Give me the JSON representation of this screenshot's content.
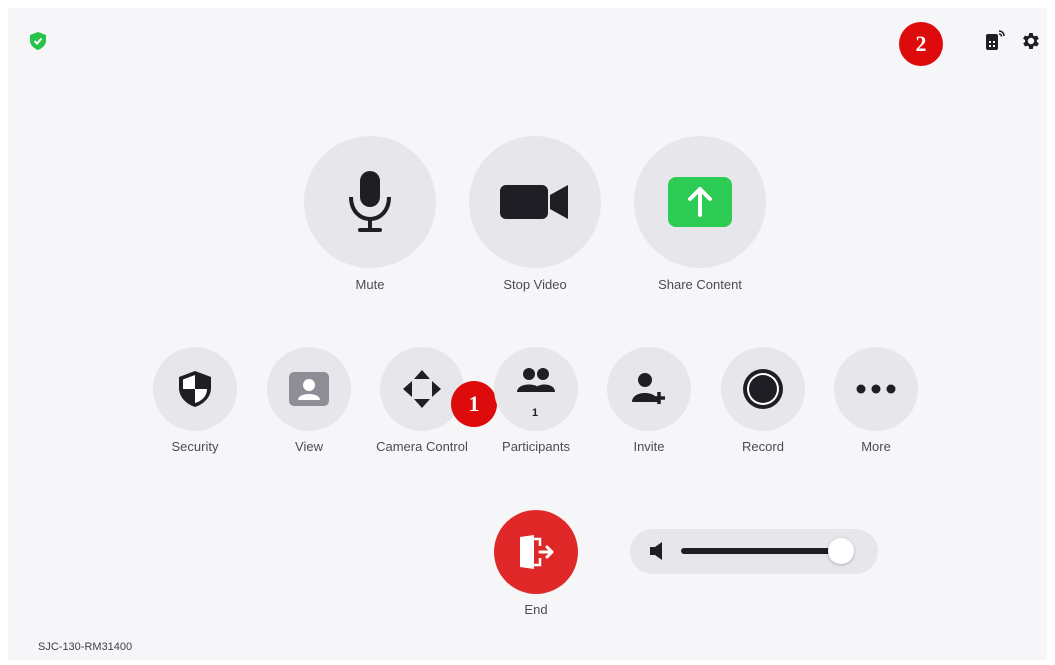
{
  "header": {
    "shield_icon": "shield-check-icon",
    "shield_color": "#26c24a",
    "remote_icon": "remote-control-icon",
    "settings_icon": "gear-icon"
  },
  "main_controls": [
    {
      "label": "Mute",
      "icon": "microphone-icon"
    },
    {
      "label": "Stop Video",
      "icon": "video-camera-icon"
    },
    {
      "label": "Share Content",
      "icon": "share-arrow-icon",
      "accent": "#2dcc55"
    }
  ],
  "secondary_controls": [
    {
      "label": "Security",
      "icon": "security-shield-icon"
    },
    {
      "label": "View",
      "icon": "view-person-icon"
    },
    {
      "label": "Camera Control",
      "icon": "camera-control-arrows-icon"
    },
    {
      "label": "Participants",
      "icon": "participants-icon",
      "count": "1"
    },
    {
      "label": "Invite",
      "icon": "invite-person-icon"
    },
    {
      "label": "Record",
      "icon": "record-icon"
    },
    {
      "label": "More",
      "icon": "more-dots-icon"
    }
  ],
  "end": {
    "label": "End",
    "icon": "leave-door-icon",
    "color": "#e02828"
  },
  "volume": {
    "icon": "speaker-icon",
    "level": 0.95
  },
  "annotations": [
    {
      "number": "1"
    },
    {
      "number": "2"
    }
  ],
  "room_name": "SJC-130-RM31400"
}
